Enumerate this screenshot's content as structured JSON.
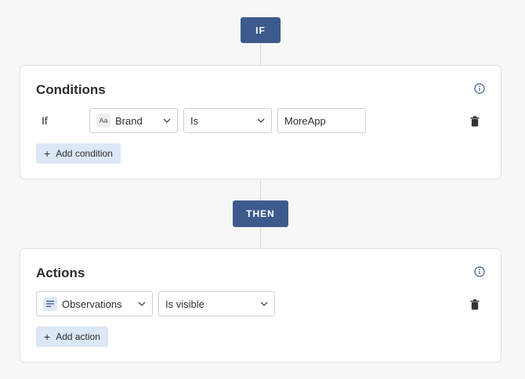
{
  "flow": {
    "if_label": "IF",
    "then_label": "THEN"
  },
  "conditions": {
    "title": "Conditions",
    "row": {
      "prefix": "If",
      "field_type_badge": "Aa",
      "field": "Brand",
      "operator": "Is",
      "value": "MoreApp"
    },
    "add_label": "Add condition"
  },
  "actions": {
    "title": "Actions",
    "row": {
      "field": "Observations",
      "action": "Is visible"
    },
    "add_label": "Add action"
  },
  "icons": {
    "info": "info-icon",
    "trash": "trash-icon",
    "chevron": "chevron-down-icon",
    "text_field": "text-field-icon",
    "lines": "lines-icon",
    "plus": "plus-icon"
  },
  "colors": {
    "accent": "#3d5a8c",
    "button_bg": "#dce7f7",
    "page_bg": "#f7f7f7"
  }
}
